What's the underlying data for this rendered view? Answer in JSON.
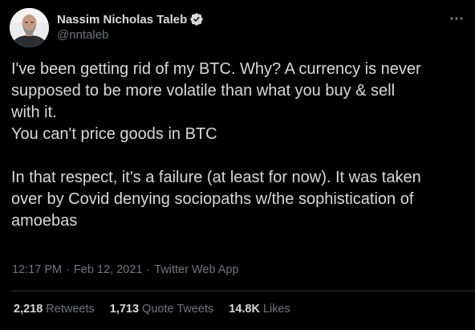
{
  "author": {
    "name": "Nassim Nicholas Taleb",
    "handle": "@nntaleb",
    "verified_icon": "verified-badge-icon",
    "avatar_icon": "avatar"
  },
  "more_icon": "more-options-icon",
  "tweet": {
    "text": "I've been getting rid of my BTC. Why? A currency is never\nsupposed to be more volatile than what you buy & sell\nwith it.\nYou can't price goods in BTC\n\nIn that respect, it's a failure (at least for now). It was taken\nover by Covid denying sociopaths w/the sophistication of\namoebas"
  },
  "meta": {
    "time": "12:17 PM",
    "separator1": "·",
    "date": "Feb 12, 2021",
    "separator2": "·",
    "source": "Twitter Web App"
  },
  "stats": {
    "retweets_count": "2,218",
    "retweets_label": "Retweets",
    "quotes_count": "1,713",
    "quotes_label": "Quote Tweets",
    "likes_count": "14.8K",
    "likes_label": "Likes"
  },
  "colors": {
    "background": "#000000",
    "text": "#d9d9d9",
    "secondary": "#6e767d",
    "divider": "#2f3336",
    "verified": "#d9d9d9"
  }
}
